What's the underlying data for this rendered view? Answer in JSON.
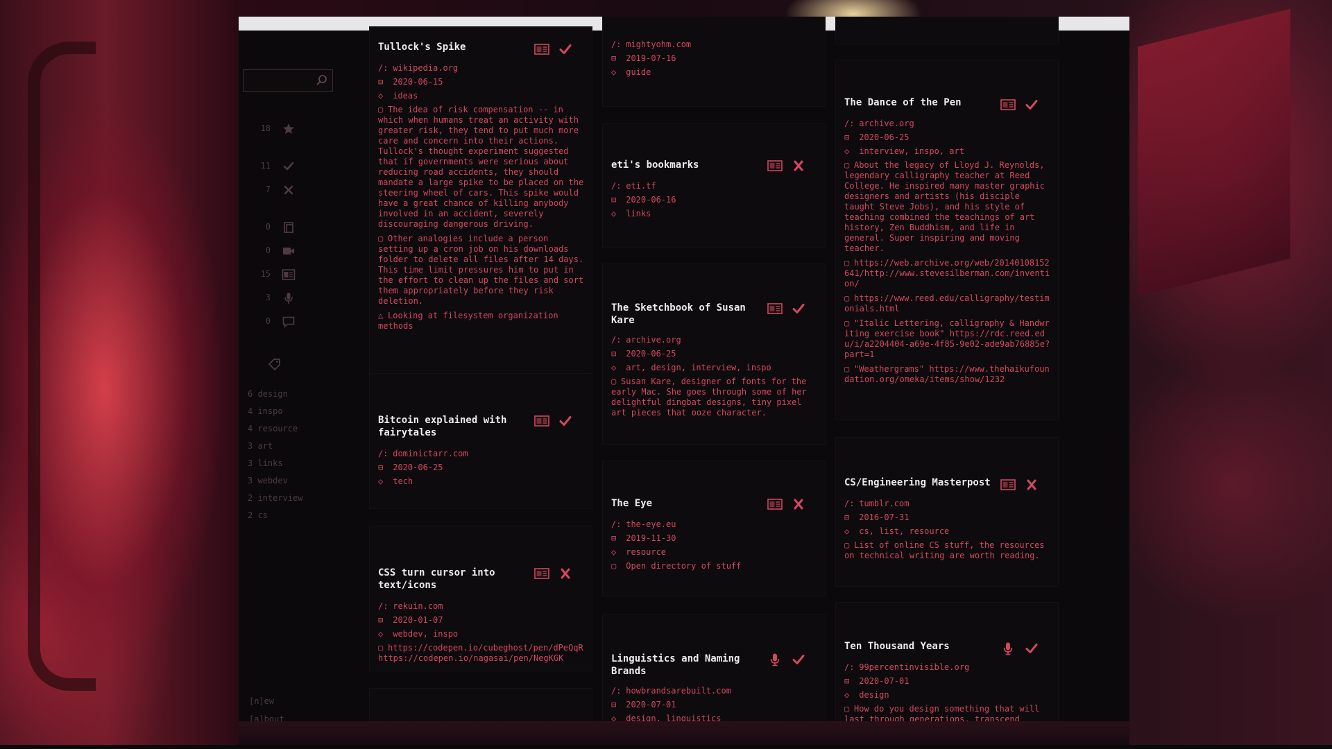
{
  "colors": {
    "accent": "#d4475f",
    "muted": "#4d3a42",
    "title": "#ececec",
    "panel": "#0b090b"
  },
  "sidebar": {
    "search": {
      "placeholder": "",
      "icon": "search-icon"
    },
    "stats": [
      {
        "count": "18",
        "icon": "star-icon"
      },
      {
        "count": "11",
        "icon": "check-icon"
      },
      {
        "count": "7",
        "icon": "x-icon"
      },
      {
        "count": "0",
        "icon": "copy-icon"
      },
      {
        "count": "0",
        "icon": "video-icon"
      },
      {
        "count": "15",
        "icon": "article-icon"
      },
      {
        "count": "3",
        "icon": "mic-icon"
      },
      {
        "count": "0",
        "icon": "comment-icon"
      }
    ],
    "tags_icon": "tag-icon",
    "tags": [
      "6 design",
      "4 inspo",
      "4 resource",
      "3 art",
      "3 links",
      "3 webdev",
      "2 interview",
      "2 cs"
    ],
    "footer": {
      "new": "[n]ew",
      "about": "[a]bout"
    }
  },
  "cards": {
    "c1": {
      "title": "Tullock's Spike",
      "site": "wikipedia.org",
      "date": "2020-06-15",
      "tags": "ideas",
      "notes": [
        "The idea of risk compensation -- in which when humans treat an activity with greater risk, they tend to put much more care and concern into their actions. Tullock's thought experiment suggested that if governments were serious about reducing road accidents, they should mandate a large spike to be placed on the steering wheel of cars. This spike would have a great chance of killing anybody involved in an accident, severely discouraging dangerous driving.",
        "Other analogies include a person setting up a cron job on his downloads folder to delete all files after 14 days. This time limit pressures him to put in the effort to clean up the files and sort them appropriately before they risk deletion.",
        "Looking at filesystem organization methods"
      ],
      "type_icon": "article-icon",
      "status_icon": "check-icon"
    },
    "c2": {
      "title": "Bitcoin explained with fairytales",
      "site": "dominictarr.com",
      "date": "2020-06-25",
      "tags": "tech",
      "type_icon": "article-icon",
      "status_icon": "check-icon"
    },
    "c3": {
      "title": "CSS turn cursor into text/icons",
      "site": "rekuin.com",
      "date": "2020-01-07",
      "tags": "webdev, inspo",
      "notes": [
        "https://codepen.io/cubeghost/pen/dPeQqR https://codepen.io/nagasai/pen/NegKGK"
      ],
      "type_icon": "article-icon",
      "status_icon": "x-icon"
    },
    "c4": {
      "site": "mightyohm.com",
      "date": "2019-07-16",
      "tags": "guide"
    },
    "c5": {
      "title": "eti's bookmarks",
      "site": "eti.tf",
      "date": "2020-06-16",
      "tags": "links",
      "type_icon": "article-icon",
      "status_icon": "x-icon"
    },
    "c6": {
      "title": "The Sketchbook of Susan Kare",
      "site": "archive.org",
      "date": "2020-06-25",
      "tags": "art, design, interview, inspo",
      "notes": [
        "Susan Kare, designer of fonts for the early Mac. She goes through some of her delightful dingbat designs, tiny pixel art pieces that ooze character."
      ],
      "type_icon": "article-icon",
      "status_icon": "check-icon"
    },
    "c7": {
      "title": "The Eye",
      "site": "the-eye.eu",
      "date": "2019-11-30",
      "tags": "resource",
      "notes": [
        "Open directory of stuff"
      ],
      "type_icon": "article-icon",
      "status_icon": "x-icon"
    },
    "c8": {
      "title": "Linguistics and Naming Brands",
      "site": "howbrandsarebuilt.com",
      "date": "2020-07-01",
      "tags": "design, linguistics",
      "type_icon": "mic-icon",
      "status_icon": "check-icon"
    },
    "c9": {
      "title": "The Dance of the Pen",
      "site": "archive.org",
      "date": "2020-06-25",
      "tags": "interview, inspo, art",
      "notes": [
        "About the legacy of Lloyd J. Reynolds, legendary calligraphy teacher at Reed College. He inspired many master graphic designers and artists (his disciple taught Steve Jobs), and his style of teaching combined the teachings of art history, Zen Buddhism, and life in general. Super inspiring and moving teacher.",
        "https://web.archive.org/web/20140108152641/http://www.stevesilberman.com/invention/",
        "https://www.reed.edu/calligraphy/testimonials.html",
        "\"Italic Lettering, calligraphy & Handwriting exercise book\" https://rdc.reed.edu/i/a2204404-a69e-4f85-9e02-ade9ab76885e?part=1",
        "\"Weathergrams\" https://www.thehaikufoundation.org/omeka/items/show/1232"
      ],
      "type_icon": "article-icon",
      "status_icon": "check-icon"
    },
    "c10": {
      "title": "CS/Engineering Masterpost",
      "site": "tumblr.com",
      "date": "2016-07-31",
      "tags": "cs, list, resource",
      "notes": [
        "List of online CS stuff, the resources on technical writing are worth reading."
      ],
      "type_icon": "article-icon",
      "status_icon": "x-icon"
    },
    "c11": {
      "title": "Ten Thousand Years",
      "site": "99percentinvisible.org",
      "date": "2020-07-01",
      "tags": "design",
      "notes": [
        "How do you design something that will last through generations, transcend"
      ],
      "type_icon": "mic-icon",
      "status_icon": "check-icon"
    }
  },
  "meta_prefix": {
    "site": "/:"
  }
}
